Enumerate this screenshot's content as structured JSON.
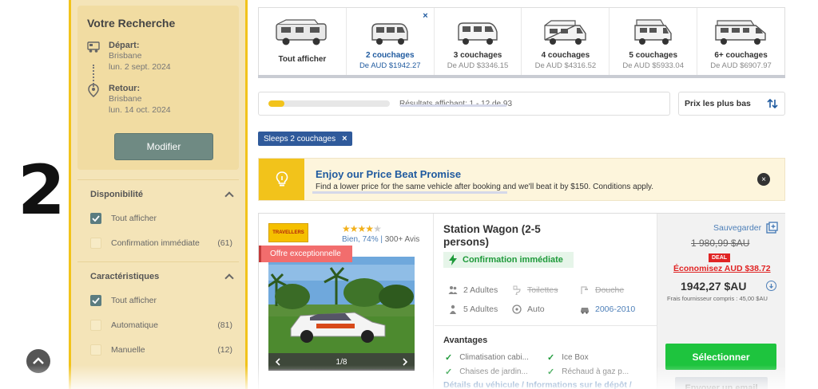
{
  "step_number": "2",
  "sidebar": {
    "title": "Votre Recherche",
    "departure": {
      "label": "Départ:",
      "city": "Brisbane",
      "date": "lun. 2 sept. 2024"
    },
    "return": {
      "label": "Retour:",
      "city": "Brisbane",
      "date": "lun. 14 oct. 2024"
    },
    "modify_label": "Modifier",
    "availability": {
      "title": "Disponibilité",
      "items": [
        {
          "label": "Tout afficher",
          "count": "",
          "checked": true
        },
        {
          "label": "Confirmation immédiate",
          "count": "(61)",
          "checked": false
        }
      ]
    },
    "features": {
      "title": "Caractéristiques",
      "items": [
        {
          "label": "Tout afficher",
          "count": "",
          "checked": true
        },
        {
          "label": "Automatique",
          "count": "(81)",
          "checked": false
        },
        {
          "label": "Manuelle",
          "count": "(12)",
          "checked": false
        }
      ]
    }
  },
  "tabs": [
    {
      "name": "Tout afficher",
      "price": ""
    },
    {
      "name": "2 couchages",
      "price": "De AUD $1942.27",
      "active": true
    },
    {
      "name": "3 couchages",
      "price": "De AUD $3346.15"
    },
    {
      "name": "4 couchages",
      "price": "De AUD $4316.52"
    },
    {
      "name": "5 couchages",
      "price": "De AUD $5933.04"
    },
    {
      "name": "6+ couchages",
      "price": "De AUD $6907.97"
    }
  ],
  "tab_close": "×",
  "results": {
    "text": "Résultats affichant: 1 - 12 de 93",
    "progress_fraction": 0.13
  },
  "sort": {
    "label": "Prix les plus bas",
    "icon": "sort-arrows-icon"
  },
  "chip": {
    "label": "Sleeps 2 couchages",
    "remove": "×"
  },
  "promise": {
    "title": "Enjoy our Price Beat Promise",
    "body": "Find a lower price for the same vehicle after booking and we'll beat it by $150. Conditions apply.",
    "close": "×"
  },
  "card": {
    "brand_logo_text": "TRAVELLERS",
    "rating_stars": 4,
    "rating_max": 5,
    "rating_text": "Bien, 74% |",
    "reviews": "300+ Avis",
    "ribbon": "Offre exceptionnelle",
    "photo_counter": "1/8",
    "name": "Station Wagon (2-5 persons)",
    "confirmation": "Confirmation immédiate",
    "specs": {
      "adults_sleep": "2 Adultes",
      "toilets": "Toilettes",
      "shower": "Douche",
      "adults_seat": "5 Adultes",
      "transmission": "Auto",
      "years": "2006-2010"
    },
    "advantages_title": "Avantages",
    "advantages": [
      "Climatisation cabi...",
      "Ice Box",
      "Chaises de jardin...",
      "Réchaud à gaz p..."
    ],
    "details_link": "Détails du véhicule / Informations sur le dépôt /",
    "save_label": "Sauvegarder",
    "old_price": "1 980,99 $AU",
    "deal": "DEAL",
    "savings": "Économisez AUD $38.72",
    "price": "1942,27 $AU",
    "fee_note": "Frais fournisseur compris : 45,00 $AU",
    "select_label": "Sélectionner",
    "email_label": "Envoyer un email"
  },
  "colors": {
    "accent_yellow": "#f2c31b",
    "primary_blue": "#1f5a9f",
    "select_green": "#1ec43e",
    "deal_red": "#e02424"
  }
}
